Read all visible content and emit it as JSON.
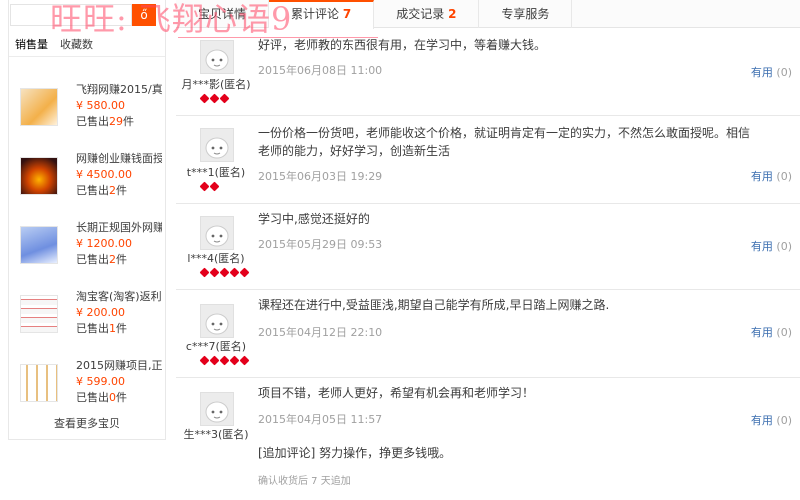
{
  "search": {
    "button_label": "ő"
  },
  "side_tabs": [
    "销售量",
    "收藏数"
  ],
  "products": [
    {
      "title": "飞翔网赚2015/真",
      "price": "¥ 580.00",
      "sold_prefix": "已售出",
      "sold_count": "29",
      "sold_suffix": "件"
    },
    {
      "title": "网赚创业赚钱面授",
      "price": "¥ 4500.00",
      "sold_prefix": "已售出",
      "sold_count": "2",
      "sold_suffix": "件"
    },
    {
      "title": "长期正规国外网赚",
      "price": "¥ 1200.00",
      "sold_prefix": "已售出",
      "sold_count": "2",
      "sold_suffix": "件"
    },
    {
      "title": "淘宝客(淘客)返利",
      "price": "¥ 200.00",
      "sold_prefix": "已售出",
      "sold_count": "1",
      "sold_suffix": "件"
    },
    {
      "title": "2015网赚项目,正",
      "price": "¥ 599.00",
      "sold_prefix": "已售出",
      "sold_count": "0",
      "sold_suffix": "件"
    }
  ],
  "more_link": "查看更多宝贝",
  "tabs": [
    {
      "label": "宝贝详情",
      "count": ""
    },
    {
      "label": "累计评论",
      "count": "7"
    },
    {
      "label": "成交记录",
      "count": "2"
    },
    {
      "label": "专享服务",
      "count": ""
    }
  ],
  "watermark": "旺旺: 飞翔心语9",
  "reviews": [
    {
      "content": "好评，老师教的东西很有用，在学习中，等着赚大钱。",
      "date": "2015年06月08日 11:00",
      "user": "月***影(匿名)",
      "badges": 3,
      "useful_label": "有用",
      "useful_count": "(0)"
    },
    {
      "content": "一份价格一份货吧，老师能收这个价格，就证明肯定有一定的实力，不然怎么敢面授呢。相信老师的能力，好好学习，创造新生活",
      "date": "2015年06月03日 19:29",
      "user": "t***1(匿名)",
      "badges": 2,
      "useful_label": "有用",
      "useful_count": "(0)"
    },
    {
      "content": "学习中,感觉还挺好的",
      "date": "2015年05月29日 09:53",
      "user": "l***4(匿名)",
      "badges": 5,
      "useful_label": "有用",
      "useful_count": "(0)"
    },
    {
      "content": "课程还在进行中,受益匪浅,期望自己能学有所成,早日踏上网赚之路.",
      "date": "2015年04月12日 22:10",
      "user": "c***7(匿名)",
      "badges": 5,
      "useful_label": "有用",
      "useful_count": "(0)"
    },
    {
      "content": "项目不错，老师人更好，希望有机会再和老师学习！",
      "date": "2015年04月05日 11:57",
      "user": "生***3(匿名)",
      "badges": 0,
      "useful_label": "有用",
      "useful_count": "(0)"
    }
  ],
  "append": {
    "content": "[追加评论] 努力操作，挣更多钱哦。",
    "note": "确认收货后 7 天追加"
  },
  "colors": {
    "accent": "#ff5000",
    "price": "#ff4400",
    "link": "#3d6fb0",
    "badge": "#e3001b"
  }
}
